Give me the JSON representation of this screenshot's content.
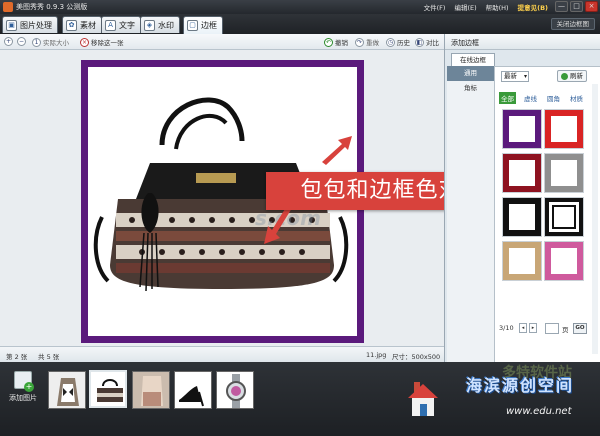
{
  "window": {
    "title": "美图秀秀 0.9.3 公测版",
    "menus": [
      "文件(F)",
      "编辑(E)",
      "帮助(H)"
    ],
    "feedback": "提意见(B)",
    "controls": [
      "—",
      "□",
      "×"
    ]
  },
  "tabs": [
    {
      "label": "图片处理",
      "icon": "image-process-icon"
    },
    {
      "label": "素材",
      "icon": "material-icon"
    },
    {
      "label": "文字",
      "icon": "text-icon"
    },
    {
      "label": "水印",
      "icon": "watermark-icon"
    },
    {
      "label": "边框",
      "icon": "frame-icon"
    }
  ],
  "close_panel_label": "关闭边框图",
  "toolbar": {
    "actual_size": "实际大小",
    "remove_one": "移除这一张",
    "undo": "撤销",
    "redo": "重做",
    "history": "历史",
    "compare": "对比"
  },
  "callout_text": "包包和边框色对比",
  "watermark_text": "s.com",
  "status": {
    "index": "第 2 张",
    "total": "共 5 张",
    "filename": "11.jpg",
    "size": "尺寸：500x500"
  },
  "filmstrip": {
    "add_label": "添加图片"
  },
  "right_panel": {
    "title": "添加边框",
    "online_tab": "在线边框",
    "categories": [
      "通用",
      "角标"
    ],
    "sort_value": "最新",
    "refresh_label": "刷新",
    "filters": [
      "全部",
      "虚线",
      "圆角",
      "材质"
    ],
    "page_current": "3/10",
    "page_unit": "页",
    "go_label": "GO",
    "frames": [
      {
        "name": "purple",
        "color": "#5b1a7c"
      },
      {
        "name": "red",
        "color": "#d92424"
      },
      {
        "name": "dark-red",
        "color": "#8e1220"
      },
      {
        "name": "gray",
        "color": "#8f8f8f"
      },
      {
        "name": "black",
        "color": "#111111"
      },
      {
        "name": "black-double",
        "color": "#111111"
      },
      {
        "name": "wood",
        "color": "#c8a676"
      },
      {
        "name": "pink",
        "color": "#cf5a9d"
      }
    ]
  },
  "site_logo": {
    "main": "海滨源创空间",
    "sub": "www.edu.net",
    "faded": "多特软件站"
  },
  "accent": "#d8423c"
}
